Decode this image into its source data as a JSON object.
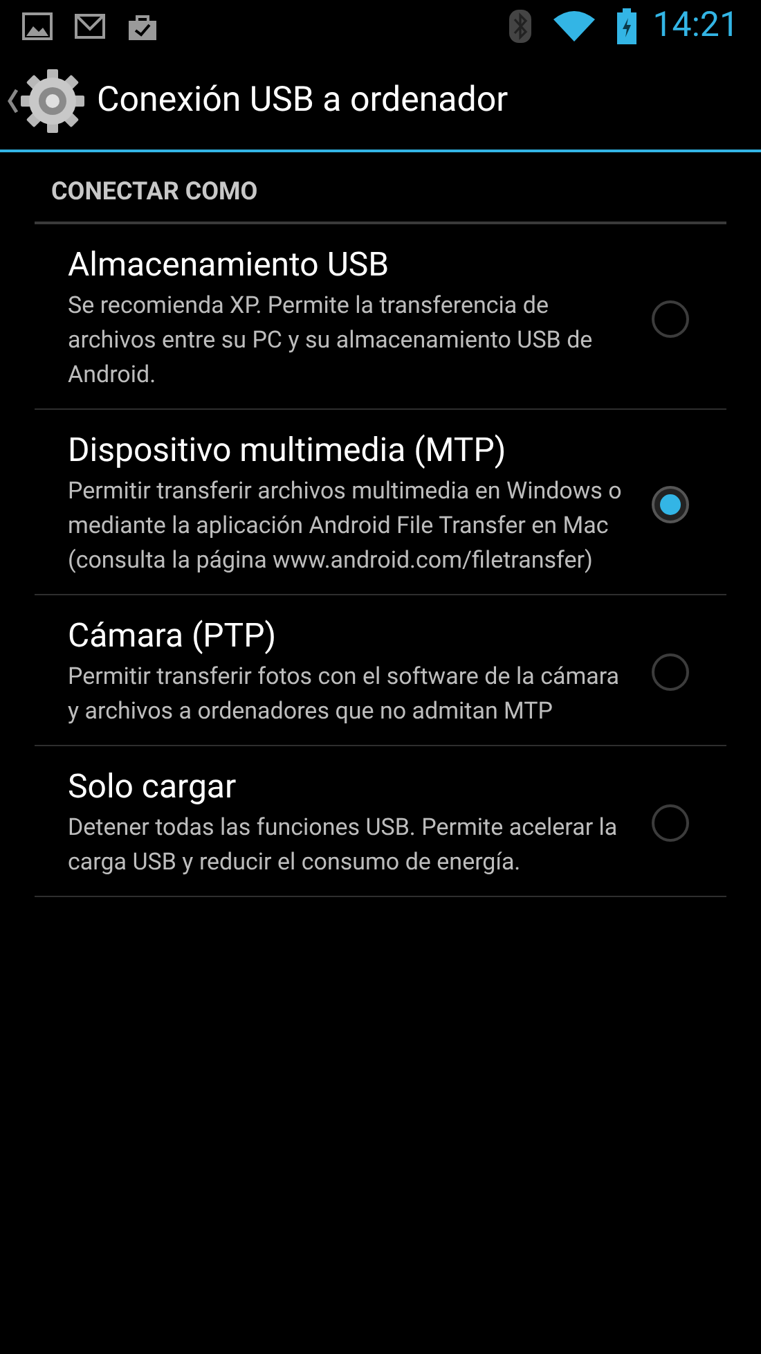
{
  "status_bar": {
    "time": "14:21"
  },
  "action_bar": {
    "title": "Conexión USB a ordenador"
  },
  "section": {
    "title": "CONECTAR COMO"
  },
  "options": [
    {
      "title": "Almacenamiento USB",
      "summary": "Se recomienda XP. Permite la transferencia de archivos entre su PC y su almacenamiento USB de Android.",
      "selected": false
    },
    {
      "title": "Dispositivo multimedia (MTP)",
      "summary": "Permitir transferir archivos multimedia en Windows o mediante la aplicación Android File Transfer en Mac (consulta la página www.android.com/filetransfer)",
      "selected": true
    },
    {
      "title": "Cámara (PTP)",
      "summary": "Permitir transferir fotos con el software de la cámara y archivos a ordenadores que no admitan MTP",
      "selected": false
    },
    {
      "title": "Solo cargar",
      "summary": "Detener todas las funciones USB. Permite acelerar la carga USB y reducir el consumo de energía.",
      "selected": false
    }
  ]
}
